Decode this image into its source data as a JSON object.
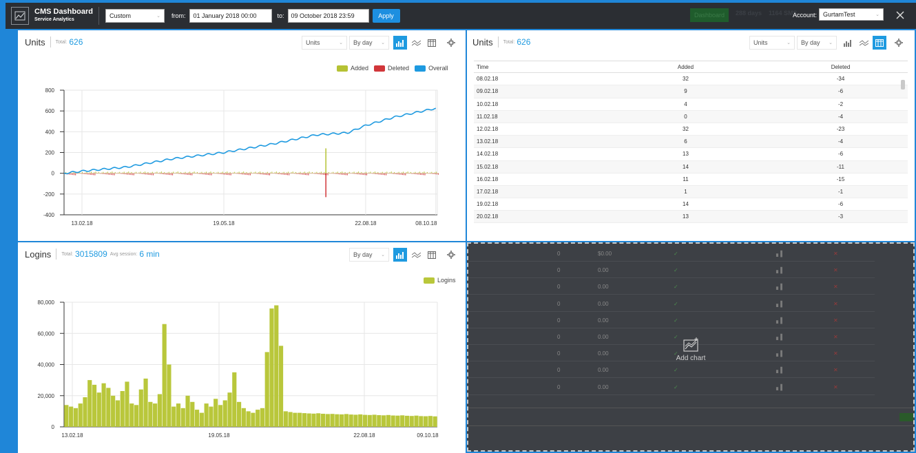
{
  "header": {
    "app_title": "CMS Dashboard",
    "app_subtitle": "Service Analytics",
    "range_preset": "Custom",
    "from_label": "from:",
    "from_value": "01 January 2018 00:00",
    "to_label": "to:",
    "to_value": "09 October 2018 23:59",
    "apply_label": "Apply",
    "bg_tab": "Dashboard",
    "bg_days": "288 days",
    "bg_count": "1164 SMS",
    "account_label": "Account:",
    "account_value": "GurtamTest"
  },
  "panels": {
    "units_chart": {
      "title": "Units",
      "total_label": "Total:",
      "total_value": "626",
      "dropdown_metric": "Units",
      "dropdown_period": "By day"
    },
    "units_table": {
      "title": "Units",
      "total_label": "Total:",
      "total_value": "626",
      "dropdown_metric": "Units",
      "dropdown_period": "By day",
      "columns": [
        "Time",
        "Added",
        "Deleted"
      ],
      "rows": [
        [
          "08.02.18",
          "32",
          "-34"
        ],
        [
          "09.02.18",
          "9",
          "-6"
        ],
        [
          "10.02.18",
          "4",
          "-2"
        ],
        [
          "11.02.18",
          "0",
          "-4"
        ],
        [
          "12.02.18",
          "32",
          "-23"
        ],
        [
          "13.02.18",
          "6",
          "-4"
        ],
        [
          "14.02.18",
          "13",
          "-6"
        ],
        [
          "15.02.18",
          "14",
          "-11"
        ],
        [
          "16.02.18",
          "11",
          "-15"
        ],
        [
          "17.02.18",
          "1",
          "-1"
        ],
        [
          "19.02.18",
          "14",
          "-6"
        ],
        [
          "20.02.18",
          "13",
          "-3"
        ]
      ]
    },
    "logins_chart": {
      "title": "Logins",
      "total_label": "Total:",
      "total_value": "3015809",
      "avg_label": "Avg session:",
      "avg_value": "6 min",
      "dropdown_period": "By day"
    },
    "add_chart": {
      "label": "Add chart"
    }
  },
  "background_rows": [
    {
      "a": "0",
      "b": "$0.00"
    },
    {
      "a": "0",
      "b": "0.00"
    },
    {
      "a": "0",
      "b": "0.00"
    },
    {
      "a": "0",
      "b": "0.00"
    },
    {
      "a": "0",
      "b": "0.00"
    },
    {
      "a": "0",
      "b": "0.00"
    },
    {
      "a": "0",
      "b": "0.00"
    },
    {
      "a": "0",
      "b": "0.00"
    },
    {
      "a": "0",
      "b": "0.00"
    }
  ],
  "colors": {
    "added": "#b5c234",
    "deleted": "#d1363a",
    "overall": "#1e9ae0",
    "logins": "#b9c73b",
    "accent": "#1e9ae0"
  },
  "chart_data": [
    {
      "type": "line",
      "title": "",
      "xlabel": "",
      "ylabel": "",
      "x_ticks": [
        "13.02.18",
        "19.05.18",
        "22.08.18",
        "08.10.18"
      ],
      "ylim": [
        -400,
        800
      ],
      "y_ticks": [
        -400,
        -200,
        0,
        200,
        400,
        600,
        800
      ],
      "grid": true,
      "legend_position": "top-right",
      "series": [
        {
          "name": "Added",
          "kind": "bar",
          "approx_daily_range": [
            0,
            30
          ],
          "spike": {
            "x": "~26.07.18",
            "value": 240
          }
        },
        {
          "name": "Deleted",
          "kind": "bar",
          "approx_daily_range": [
            -30,
            0
          ],
          "spike": {
            "x": "~26.07.18",
            "value": -230
          }
        },
        {
          "name": "Overall",
          "kind": "line",
          "points": [
            [
              "01.02.18",
              0
            ],
            [
              "13.02.18",
              20
            ],
            [
              "15.03.18",
              60
            ],
            [
              "15.04.18",
              140
            ],
            [
              "19.05.18",
              200
            ],
            [
              "20.06.18",
              280
            ],
            [
              "20.07.18",
              370
            ],
            [
              "10.08.18",
              390
            ],
            [
              "22.08.18",
              460
            ],
            [
              "10.09.18",
              540
            ],
            [
              "08.10.18",
              626
            ]
          ]
        }
      ]
    },
    {
      "type": "bar",
      "title": "",
      "xlabel": "",
      "ylabel": "",
      "x_ticks": [
        "13.02.18",
        "19.05.18",
        "22.08.18",
        "09.10.18"
      ],
      "ylim": [
        0,
        80000
      ],
      "y_ticks": [
        "0",
        "20,000",
        "40,000",
        "60,000",
        "80,000"
      ],
      "grid": true,
      "legend_position": "top-right",
      "series": [
        {
          "name": "Logins",
          "approx_values": [
            14000,
            13000,
            12000,
            15000,
            19000,
            30000,
            27000,
            22000,
            28000,
            25000,
            20000,
            17000,
            23000,
            29000,
            15000,
            14000,
            24000,
            31000,
            16000,
            15000,
            21000,
            66000,
            40000,
            13000,
            15000,
            12000,
            20000,
            16000,
            11000,
            9000,
            15000,
            13000,
            18000,
            14000,
            17000,
            22000,
            35000,
            16000,
            12000,
            10000,
            9000,
            11000,
            12000,
            48000,
            76000,
            78000,
            52000,
            10000,
            9500,
            9000,
            9000,
            8800,
            8600,
            8500,
            8700,
            8400,
            8200,
            8300,
            8100,
            8000,
            8200,
            7900,
            7800,
            8000,
            7700,
            7600,
            7800,
            7500,
            7400,
            7600,
            7300,
            7200,
            7400,
            7100,
            7000,
            7200,
            6900,
            6800,
            7000,
            6700
          ]
        }
      ]
    }
  ]
}
